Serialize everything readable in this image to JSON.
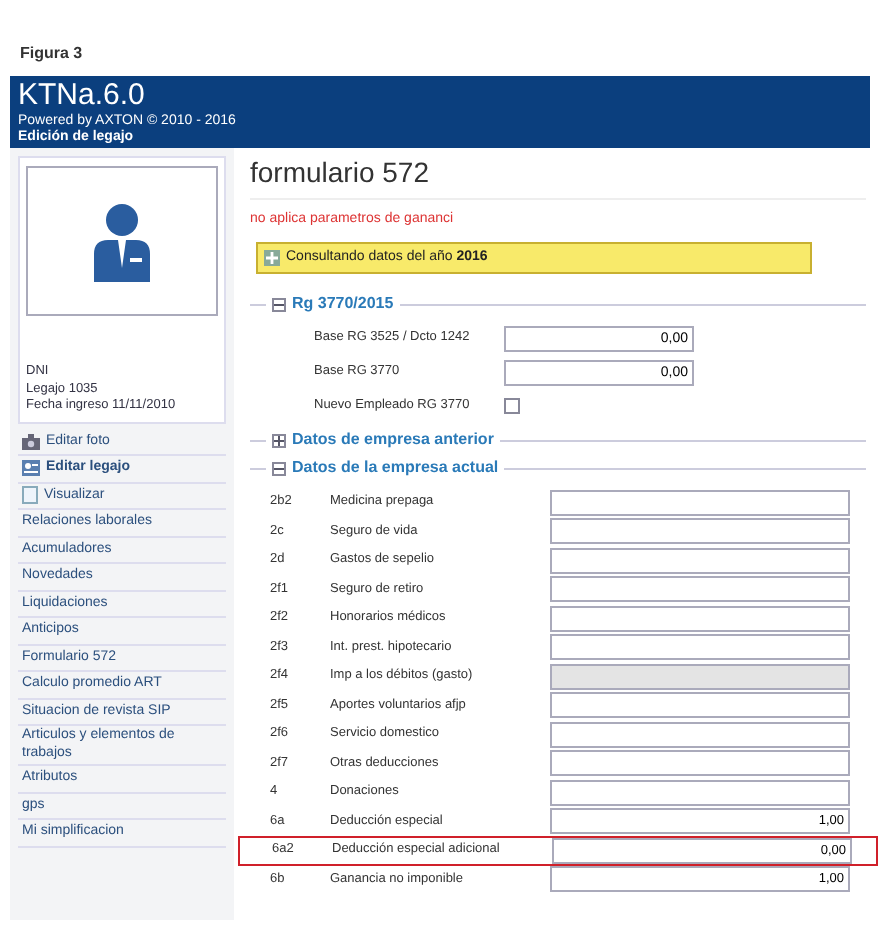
{
  "figure_label": "Figura 3",
  "header": {
    "title": "KTNa.6.0",
    "powered_by": "Powered by AXTON © 2010 - 2016",
    "subtitle": "Edición de legajo"
  },
  "profile": {
    "lines": [
      "DNI",
      "Legajo 1035",
      "Fecha ingreso 11/11/2010"
    ]
  },
  "sidebar": {
    "items": [
      {
        "label": "Editar foto",
        "kind": "icon_link",
        "bold": false
      },
      {
        "label": "Editar legajo",
        "kind": "icon_link",
        "bold": true
      },
      {
        "label": "Visualizar",
        "kind": "icon_link",
        "bold": false
      },
      {
        "label": "Relaciones laborales"
      },
      {
        "label": "Acumuladores"
      },
      {
        "label": "Novedades"
      },
      {
        "label": "Liquidaciones"
      },
      {
        "label": "Anticipos"
      },
      {
        "label": "Formulario 572"
      },
      {
        "label": "Calculo promedio ART"
      },
      {
        "label": "Situacion de revista SIP"
      },
      {
        "label": "Articulos y elementos de trabajos"
      },
      {
        "label": "Atributos"
      },
      {
        "label": "gps"
      },
      {
        "label": "Mi simplificacion"
      }
    ]
  },
  "page_title": "formulario 572",
  "warning": "no aplica parametros de gananci",
  "year_banner": {
    "text": "Consultando datos del año **2016**"
  },
  "sections": [
    {
      "title": "Rg 3770/2015",
      "expanded": true,
      "kind": "fields",
      "fields": [
        {
          "label": "Base RG 3525 / Dcto 1242",
          "kind": "input",
          "value": "0,00"
        },
        {
          "label": "Base RG 3770",
          "kind": "input",
          "value": "0,00"
        },
        {
          "label": "Nuevo Empleado RG 3770",
          "kind": "checkbox",
          "checked": false
        }
      ]
    },
    {
      "title": "Datos de empresa anterior",
      "expanded": false
    },
    {
      "title": "Datos de la empresa actual",
      "expanded": true,
      "kind": "rows",
      "rows": [
        {
          "code": "2b2",
          "label": "Medicina prepaga",
          "disabled": false,
          "highlighted": false
        },
        {
          "code": "2c",
          "label": "Seguro de vida",
          "disabled": false,
          "highlighted": false
        },
        {
          "code": "2d",
          "label": "Gastos de sepelio",
          "disabled": false,
          "highlighted": false
        },
        {
          "code": "2f1",
          "label": "Seguro de retiro",
          "disabled": false,
          "highlighted": false
        },
        {
          "code": "2f2",
          "label": "Honorarios médicos",
          "disabled": false,
          "highlighted": false
        },
        {
          "code": "2f3",
          "label": "Int. prest. hipotecario",
          "disabled": false,
          "highlighted": false
        },
        {
          "code": "2f4",
          "label": "Imp a los débitos (gasto)",
          "disabled": true,
          "highlighted": false
        },
        {
          "code": "2f5",
          "label": "Aportes voluntarios afjp",
          "disabled": false,
          "highlighted": false
        },
        {
          "code": "2f6",
          "label": "Servicio domestico",
          "disabled": false,
          "highlighted": false
        },
        {
          "code": "2f7",
          "label": "Otras deducciones",
          "disabled": false,
          "highlighted": false
        },
        {
          "code": "4",
          "label": "Donaciones",
          "disabled": false,
          "highlighted": false
        },
        {
          "code": "6a",
          "label": "Deducción especial",
          "value": "1,00",
          "disabled": false,
          "highlighted": false
        },
        {
          "code": "6a2",
          "label": "Deducción especial adicional",
          "value": "0,00",
          "disabled": false,
          "highlighted": true
        },
        {
          "code": "6b",
          "label": "Ganancia no imponible",
          "value": "1,00",
          "disabled": false,
          "highlighted": false
        }
      ]
    }
  ]
}
